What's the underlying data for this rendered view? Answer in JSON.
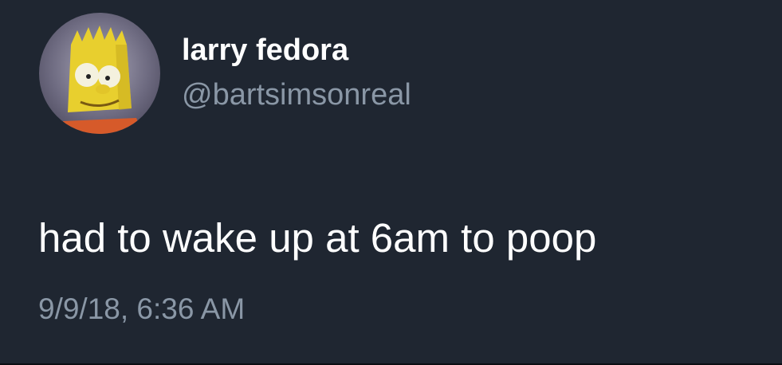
{
  "tweet": {
    "author": {
      "display_name": "larry fedora",
      "handle": "@bartsimsonreal",
      "avatar_icon": "cartoon-character-avatar"
    },
    "text": "had to wake up at 6am to poop",
    "timestamp": "9/9/18, 6:36 AM"
  },
  "colors": {
    "background": "#1f2631",
    "primary_text": "#ffffff",
    "secondary_text": "#8a97a6"
  }
}
